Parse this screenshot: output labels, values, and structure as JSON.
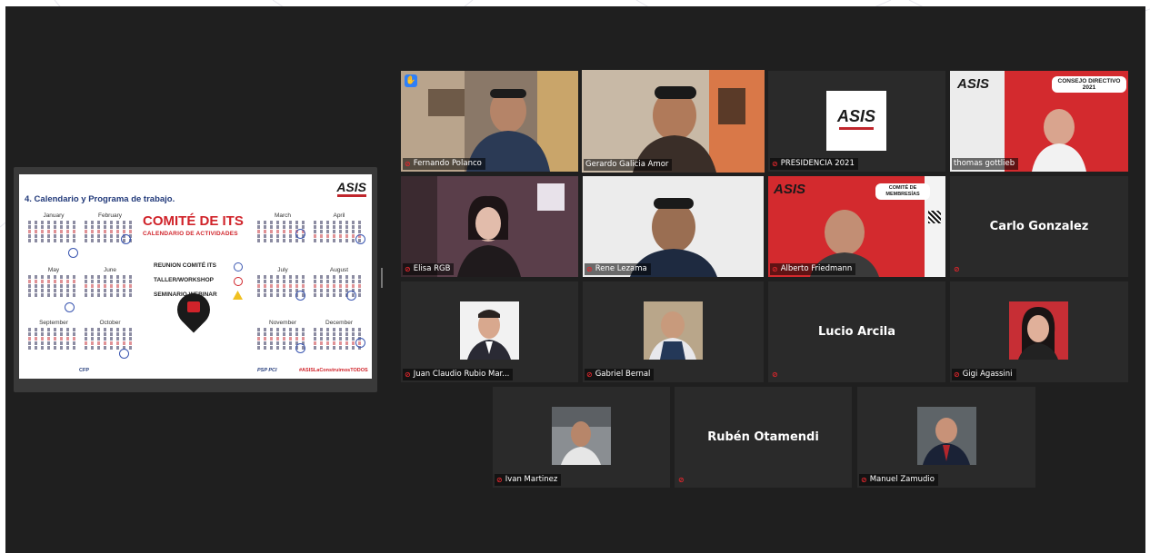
{
  "slide": {
    "title": "4. Calendario y Programa de trabajo.",
    "logo": "ASIS",
    "months": [
      "January",
      "February",
      "March",
      "April",
      "May",
      "June",
      "July",
      "August",
      "September",
      "October",
      "November",
      "December"
    ],
    "heading": "COMITÉ DE ITS",
    "subheading": "CALENDARIO DE ACTIVIDADES",
    "legend": [
      "REUNION COMITÉ ITS",
      "TALLER/WORKSHOP",
      "SEMINARIO WEBINAR"
    ],
    "footer_tag": "#ASISLaConstruimosTODOS",
    "footer_left": "CFP",
    "footer_mid": "PSP  PCI",
    "legend_colors": [
      "#3a56b0",
      "#d0232a",
      "#f0c020"
    ]
  },
  "participants": [
    {
      "name": "Fernando Polanco",
      "muted": true,
      "video": true,
      "hand_raised": true
    },
    {
      "name": "Gerardo Galicia Amor",
      "muted": false,
      "video": true,
      "active_speaker": true
    },
    {
      "name": "PRESIDENCIA 2021",
      "muted": true,
      "video": true
    },
    {
      "name": "thomas gottlieb",
      "muted": false,
      "video": true
    },
    {
      "name": "Elisa RGB",
      "muted": true,
      "video": true
    },
    {
      "name": "Rene Lezama",
      "muted": true,
      "video": true
    },
    {
      "name": "Alberto Friedmann",
      "muted": true,
      "video": true
    },
    {
      "name": "Carlo Gonzalez",
      "muted": true,
      "video": false
    },
    {
      "name": "Juan Claudio Rubio Mar...",
      "muted": true,
      "video": false
    },
    {
      "name": "Gabriel Bernal",
      "muted": true,
      "video": false
    },
    {
      "name": "Lucio Arcila",
      "muted": true,
      "video": false
    },
    {
      "name": "Gigi Agassini",
      "muted": true,
      "video": false
    },
    {
      "name": "Ivan Martinez",
      "muted": true,
      "video": false
    },
    {
      "name": "Rubén Otamendi",
      "muted": true,
      "video": false
    },
    {
      "name": "Manuel Zamudio",
      "muted": true,
      "video": false
    }
  ],
  "virtual_bg": {
    "asis_logo": "ASIS",
    "consejo_badge": "CONSEJO DIRECTIVO 2021",
    "comite_badge": "COMITÉ DE MEMBRESÍAS"
  },
  "colors": {
    "app_bg": "#1f1f1f",
    "tile_bg": "#2a2a2a",
    "active_border": "#a8d12a",
    "muted_icon": "#e0262c",
    "hand_icon": "#2d7ff9"
  }
}
